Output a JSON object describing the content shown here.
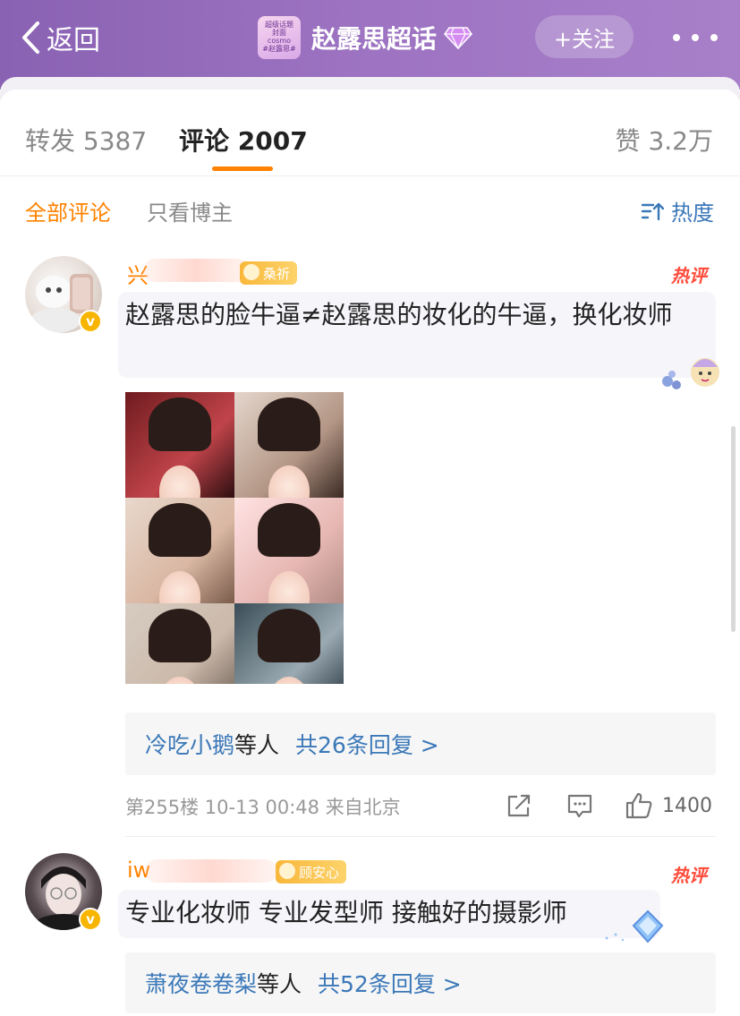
{
  "header": {
    "back_label": "返回",
    "topic_title": "赵露思超话",
    "thumb_lines": [
      "超级话题",
      "封面",
      "cosmo",
      "#赵露思#"
    ],
    "follow_label": "+关注",
    "accent_color": "#9d73c2"
  },
  "tabs": {
    "repost": "转发 5387",
    "comment": "评论 2007",
    "like": "赞 3.2万",
    "active_color": "#ff8200"
  },
  "filters": {
    "all": "全部评论",
    "owner_only": "只看博主",
    "sort": "热度"
  },
  "comments": [
    {
      "username": "兴",
      "fan_badge": "桑祈",
      "hot_label": "热评",
      "text": "赵露思的脸牛逼≠赵露思的妆化的牛逼，换化妆师",
      "replies_users": "冷吃小鹅",
      "replies_suffix": "等人",
      "replies_total": "共26条回复 >",
      "floor": "第255楼",
      "time": "10-13 00:48",
      "location": "来自北京",
      "likes": "1400"
    },
    {
      "username": "iw",
      "fan_badge": "顾安心",
      "hot_label": "热评",
      "text": "专业化妆师 专业发型师 接触好的摄影师",
      "replies_users": "萧夜卷卷梨",
      "replies_suffix": "等人",
      "replies_total": "共52条回复 >"
    }
  ],
  "icons": {
    "back": "chevron-left-icon",
    "gem": "diamond-icon",
    "more": "more-dots-icon",
    "sort": "sort-icon",
    "share": "share-icon",
    "comment": "comment-icon",
    "like": "thumbs-up-icon"
  }
}
